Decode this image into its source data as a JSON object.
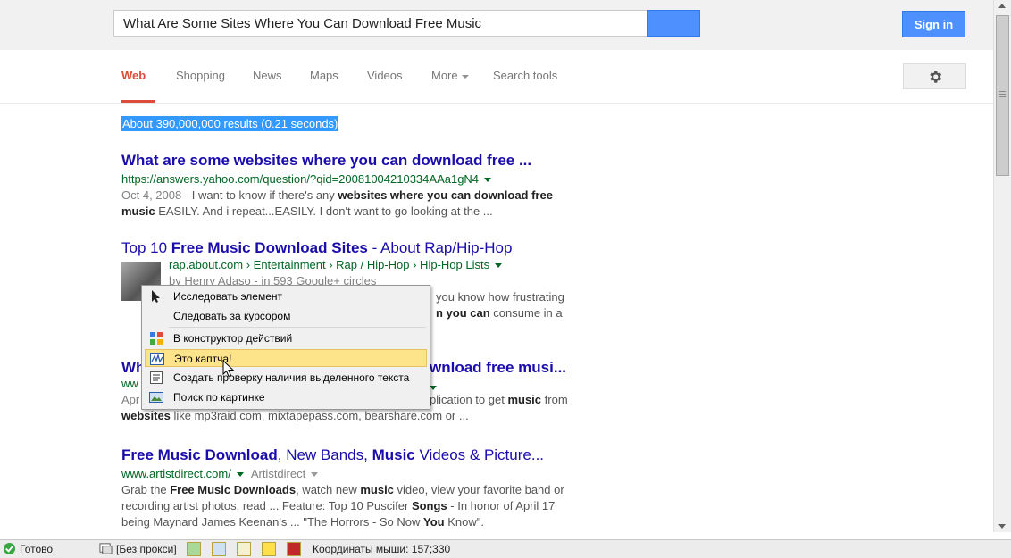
{
  "search": {
    "query": "What Are Some Sites Where You Can Download Free Music"
  },
  "header": {
    "signin_label": "Sign in"
  },
  "nav": {
    "tabs": [
      {
        "label": "Web",
        "active": true
      },
      {
        "label": "Shopping"
      },
      {
        "label": "News"
      },
      {
        "label": "Maps"
      },
      {
        "label": "Videos"
      },
      {
        "label": "More"
      },
      {
        "label": "Search tools"
      }
    ]
  },
  "results_stats": "About 390,000,000 results (0.21 seconds)",
  "results": [
    {
      "title": "What are some websites where you can download free ...",
      "url": "https://answers.yahoo.com/question/?qid=20081004210334AAa1gN4",
      "date": "Oct 4, 2008",
      "snippet_a": " - I want to know if there's any ",
      "snippet_b": "websites where you can download free music",
      "snippet_c": " EASILY. And i repeat...EASILY. I don't want to go looking at the ..."
    },
    {
      "title_a": "Top 10 ",
      "title_b": "Free Music Download Sites",
      "title_c": " - About Rap/Hip-Hop",
      "url": "rap.about.com › Entertainment › Rap / Hip-Hop › Hip-Hop Lists",
      "byline": "by Henry Adaso - in 593 Google+ circles",
      "snippet_a": "you know how frustrating",
      "snippet_b": "n you can",
      "snippet_c": " consume in a"
    },
    {
      "title_a": "Wh",
      "title_b": "wnload free musi...",
      "url": "ww",
      "snippet_a": "Apr",
      "snippet_b": "plication to get ",
      "snippet_c": "music",
      "snippet_d": " from ",
      "snippet_e": "websites",
      "snippet_f": " like mp3raid.com, mixtapepass.com, bearshare.com or ..."
    },
    {
      "title_a": "Free Music Download",
      "title_b": ", New Bands, ",
      "title_c": "Music",
      "title_d": " Videos & Picture...",
      "url": "www.artistdirect.com/",
      "site": "Artistdirect",
      "l1_a": "Grab the ",
      "l1_b": "Free Music Downloads",
      "l1_c": ", watch new ",
      "l1_d": "music",
      "l1_e": " video, view your favorite band or",
      "l2": "recording artist photos, read ... Feature: Top 10 Puscifer ",
      "l2_b": "Songs",
      "l2_c": " - In honor of April 17",
      "l3_a": "being Maynard James Keenan's ... \"The Horrors - So Now ",
      "l3_b": "You",
      "l3_c": " Know\"."
    }
  ],
  "context_menu": {
    "items": [
      {
        "label": "Исследовать элемент",
        "icon": "cursor-arrow-icon"
      },
      {
        "label": "Следовать за курсором",
        "icon": ""
      },
      {
        "label": "В конструктор действий",
        "icon": "blocks-icon"
      },
      {
        "label": "Это каптча!",
        "icon": "captcha-icon",
        "highlighted": true
      },
      {
        "label": "Создать проверку наличия выделенного текста",
        "icon": "text-check-icon"
      },
      {
        "label": "Поиск по картинке",
        "icon": "image-search-icon"
      }
    ]
  },
  "statusbar": {
    "ready": "Готово",
    "proxy": "[Без прокси]",
    "mouse_coords": "Координаты мыши: 157;330"
  }
}
